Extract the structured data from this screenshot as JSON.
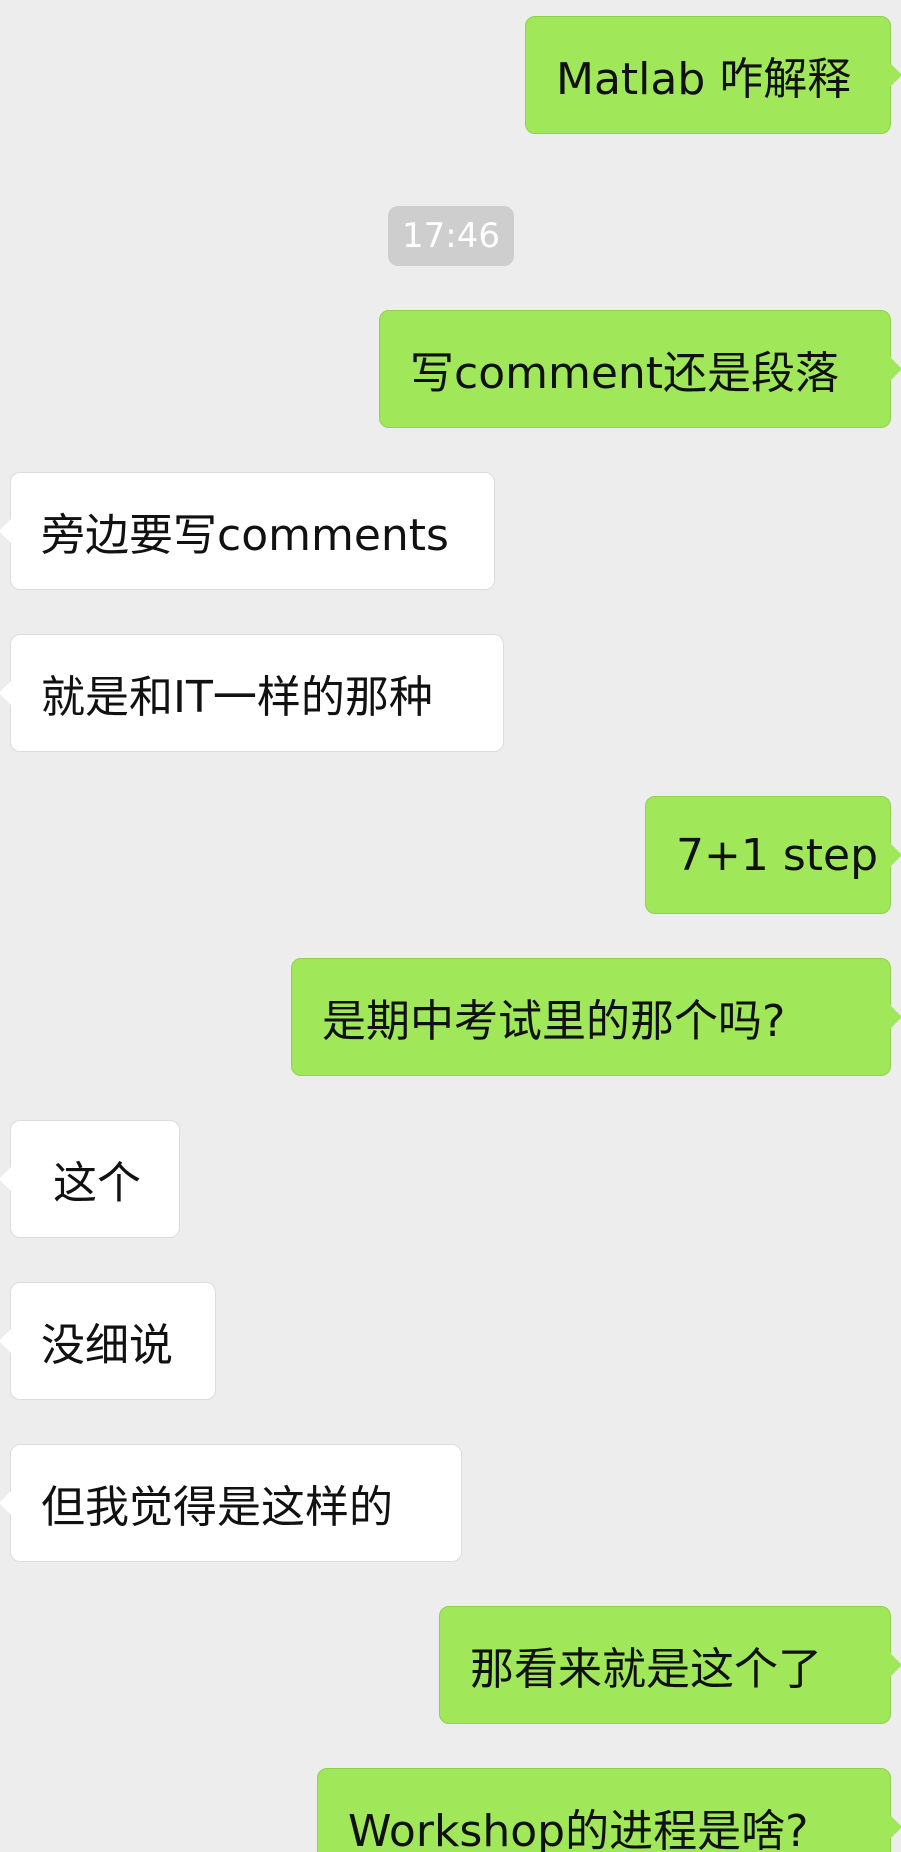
{
  "timestamp": "17:46",
  "messages": [
    {
      "side": "out",
      "text": "Matlab 咋解释"
    },
    {
      "side": "out",
      "text": "写comment还是段落"
    },
    {
      "side": "in",
      "text": "旁边要写comments"
    },
    {
      "side": "in",
      "text": "就是和IT一样的那种"
    },
    {
      "side": "out",
      "text": "7+1 step"
    },
    {
      "side": "out",
      "text": "是期中考试里的那个吗?"
    },
    {
      "side": "in",
      "text": "这个"
    },
    {
      "side": "in",
      "text": "没细说"
    },
    {
      "side": "in",
      "text": "但我觉得是这样的"
    },
    {
      "side": "out",
      "text": "那看来就是这个了"
    },
    {
      "side": "out",
      "text": "Workshop的进程是啥?"
    }
  ]
}
